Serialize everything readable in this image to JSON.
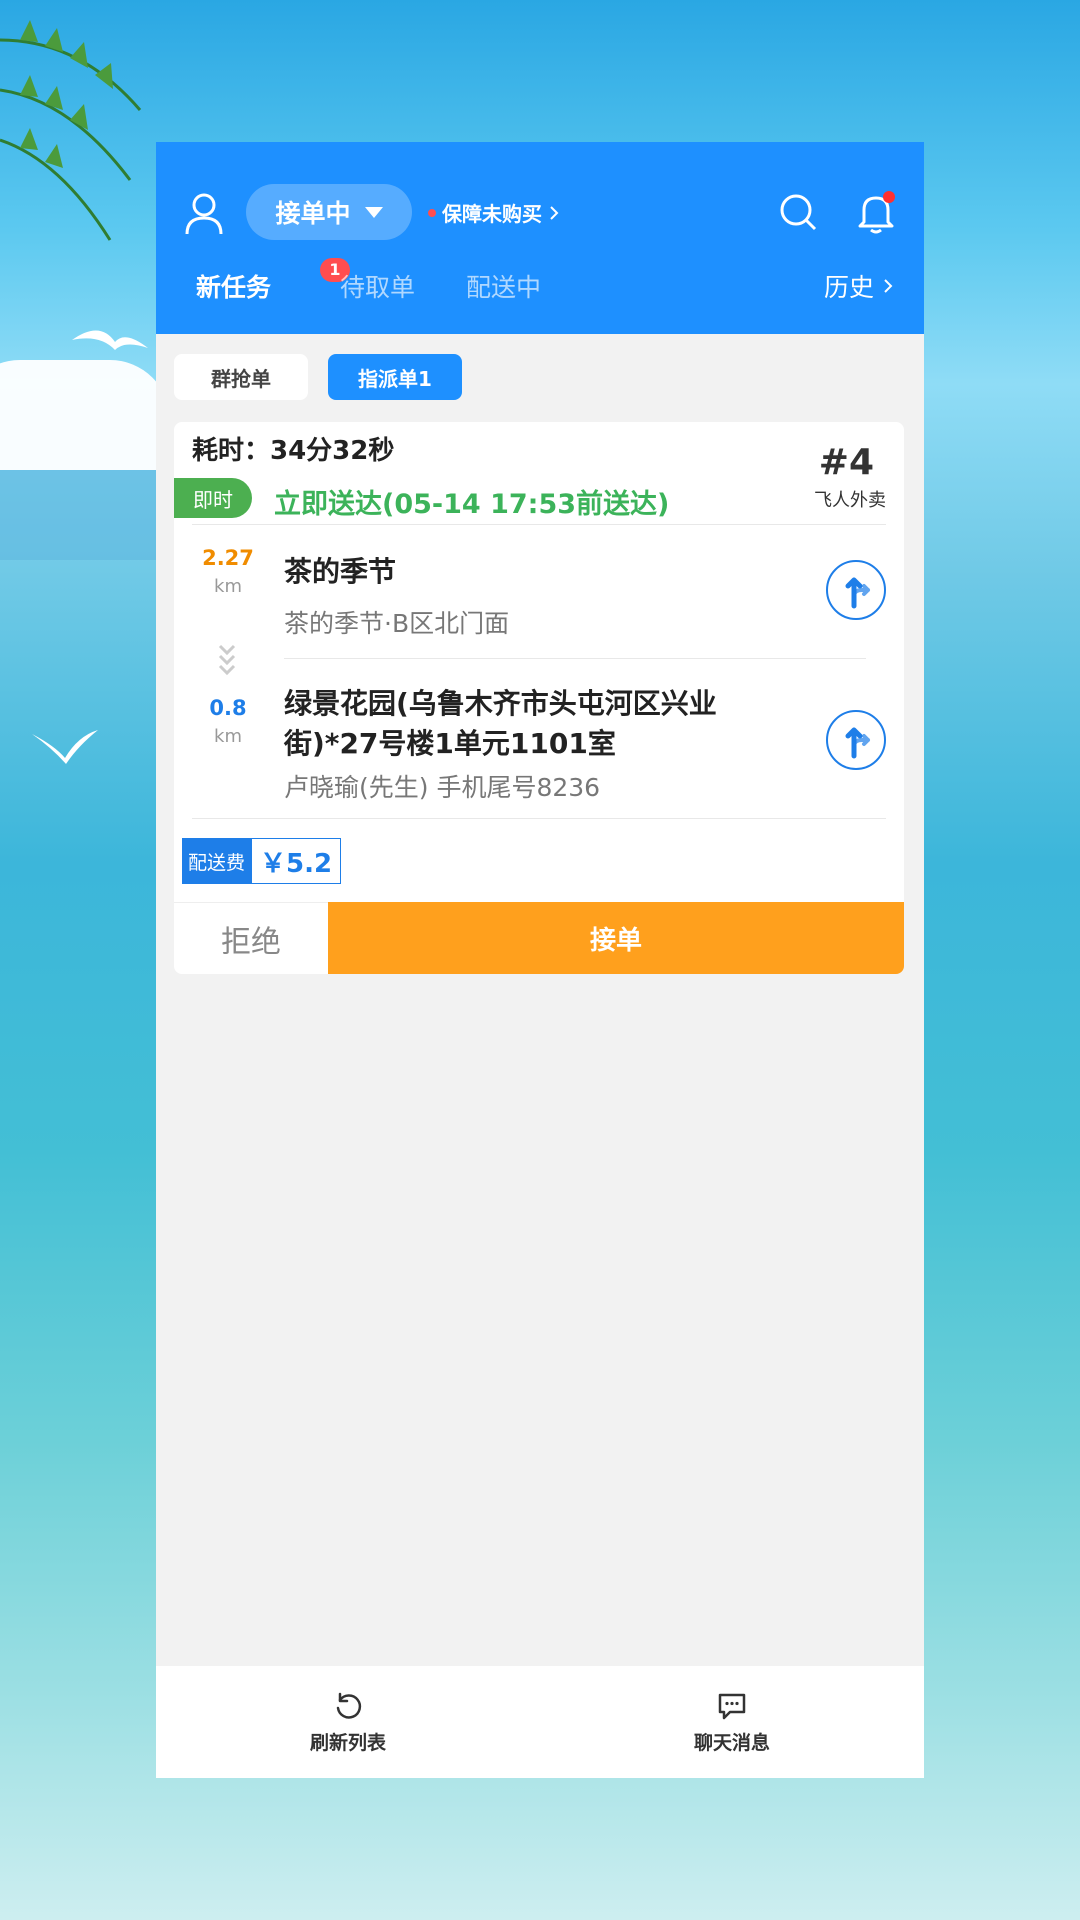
{
  "header": {
    "status": "接单中",
    "insurance": "保障未购买",
    "tabs": [
      {
        "label": "新任务",
        "badge": "1"
      },
      {
        "label": "待取单"
      },
      {
        "label": "配送中"
      }
    ],
    "history": "历史"
  },
  "subtabs": [
    "群抢单",
    "指派单1"
  ],
  "order": {
    "elapsed": "耗时：34分32秒",
    "number": "#4",
    "merchant": "飞人外卖",
    "tag": "即时",
    "deadline": "立即送达(05-14 17:53前送达)",
    "pickup": {
      "distance": "2.27",
      "unit": "km",
      "name": "茶的季节",
      "address": "茶的季节·B区北门面"
    },
    "dropoff": {
      "distance": "0.8",
      "unit": "km",
      "address_line1": "绿景花园(乌鲁木齐市头屯河区兴业",
      "address_line2": "街)*27号楼1单元1101室",
      "contact": "卢晓瑜(先生) 手机尾号8236"
    },
    "fee_label": "配送费",
    "fee_value": "￥5.2",
    "reject": "拒绝",
    "accept": "接单"
  },
  "bottom": {
    "refresh": "刷新列表",
    "chat": "聊天消息"
  },
  "colors": {
    "brand": "#1e90ff",
    "accept": "#ffa01d",
    "instant": "#4caf50",
    "deadline": "#3cb35a",
    "pickup_distance": "#f08c00",
    "dropoff_distance": "#1e7ee8"
  }
}
